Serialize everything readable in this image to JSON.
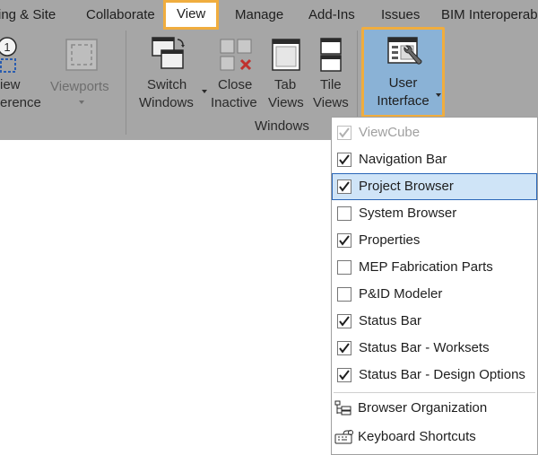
{
  "tabs": [
    {
      "label": "ing & Site"
    },
    {
      "label": "Collaborate"
    },
    {
      "label": "View",
      "active": true
    },
    {
      "label": "Manage"
    },
    {
      "label": "Add-Ins"
    },
    {
      "label": "Issues"
    },
    {
      "label": "BIM Interoperab"
    }
  ],
  "ribbon": {
    "left_partial": {
      "line1": "iew",
      "line2": "erence"
    },
    "viewports": {
      "label": "Viewports"
    },
    "switch_windows": {
      "line1": "Switch",
      "line2": "Windows"
    },
    "close_inactive": {
      "line1": "Close",
      "line2": "Inactive"
    },
    "tab_views": {
      "line1": "Tab",
      "line2": "Views"
    },
    "tile_views": {
      "line1": "Tile",
      "line2": "Views"
    },
    "user_interface": {
      "line1": "User",
      "line2": "Interface"
    },
    "panel_label": "Windows"
  },
  "menu": {
    "items": [
      {
        "label": "ViewCube",
        "checked": true,
        "enabled": false
      },
      {
        "label": "Navigation Bar",
        "checked": true
      },
      {
        "label": "Project Browser",
        "checked": true,
        "highlighted": true
      },
      {
        "label": "System Browser",
        "checked": false
      },
      {
        "label": "Properties",
        "checked": true
      },
      {
        "label": "MEP Fabrication Parts",
        "checked": false
      },
      {
        "label": "P&ID Modeler",
        "checked": false
      },
      {
        "label": "Status Bar",
        "checked": true
      },
      {
        "label": "Status Bar - Worksets",
        "checked": true
      },
      {
        "label": "Status Bar - Design Options",
        "checked": true
      }
    ],
    "actions": [
      {
        "label": "Browser Organization",
        "icon": "browser-organization-icon"
      },
      {
        "label": "Keyboard Shortcuts",
        "icon": "keyboard-shortcuts-icon"
      }
    ]
  },
  "colors": {
    "ribbon_bg": "#a6a6a6",
    "highlight_outline": "#f0ad3e",
    "button_active": "#8ab2d6",
    "menu_highlight": "#cfe4f7"
  }
}
